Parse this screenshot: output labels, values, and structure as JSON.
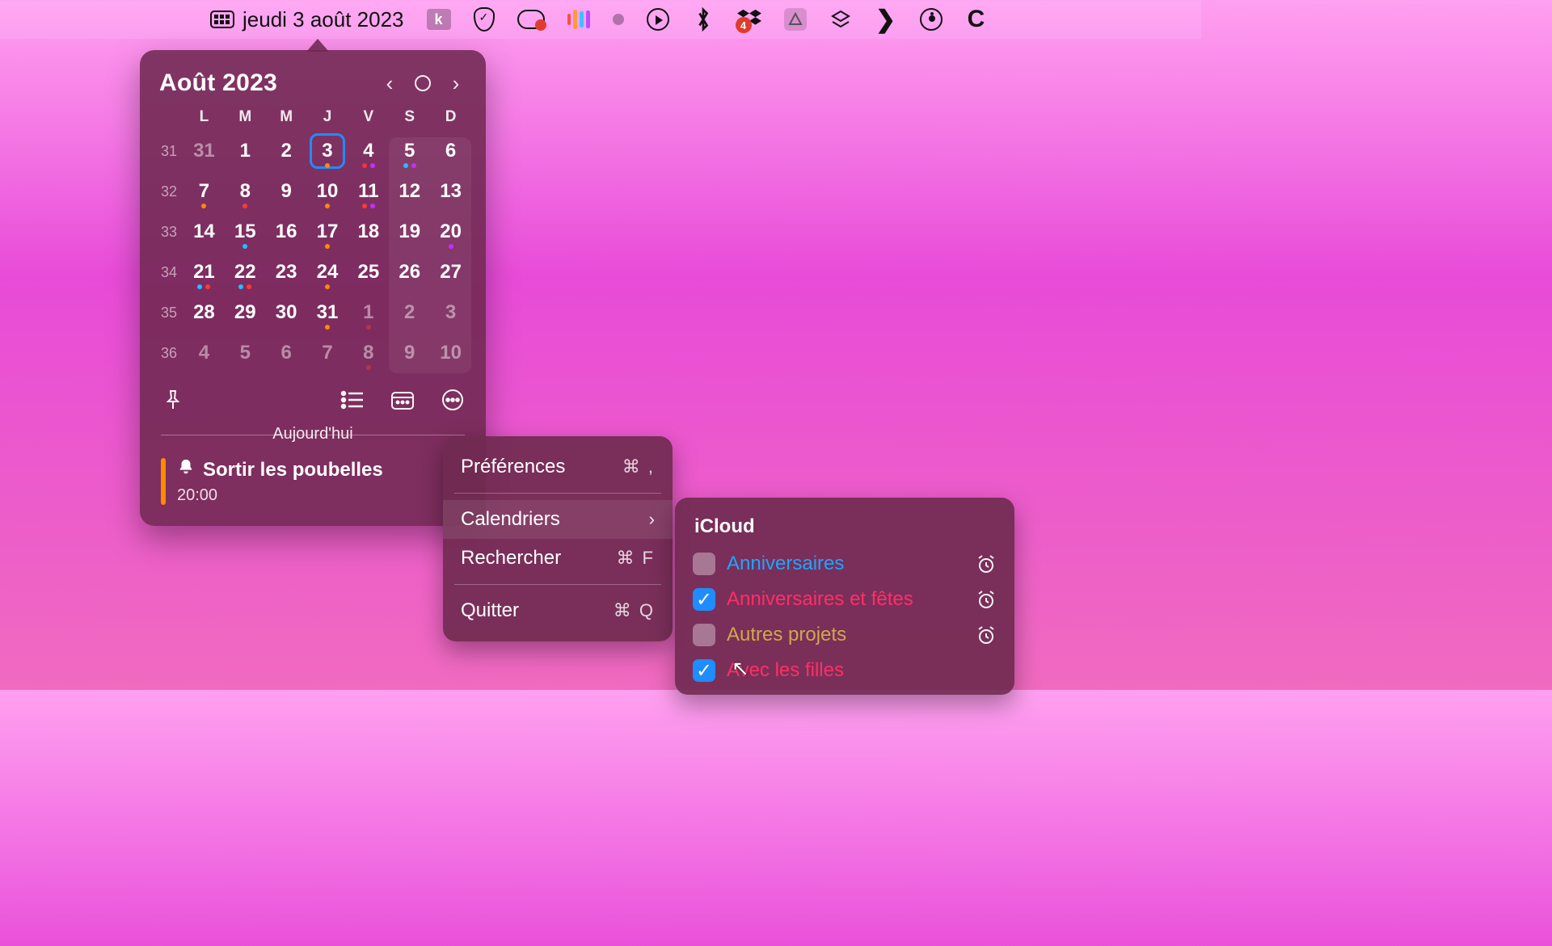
{
  "menubar": {
    "date_label": "jeudi 3 août 2023",
    "dropbox_badge": "4"
  },
  "calendar": {
    "title": "Août 2023",
    "dow": [
      "L",
      "M",
      "M",
      "J",
      "V",
      "S",
      "D"
    ],
    "weeks": [
      {
        "wk": "31",
        "days": [
          {
            "n": "31",
            "dim": true
          },
          {
            "n": "1"
          },
          {
            "n": "2"
          },
          {
            "n": "3",
            "selected": true,
            "dots": [
              "#ff8a00"
            ]
          },
          {
            "n": "4",
            "dots": [
              "#ff3030",
              "#c030ff"
            ]
          },
          {
            "n": "5",
            "dots": [
              "#20c0ff",
              "#c030ff"
            ]
          },
          {
            "n": "6"
          }
        ]
      },
      {
        "wk": "32",
        "days": [
          {
            "n": "7",
            "dots": [
              "#ff8a00"
            ]
          },
          {
            "n": "8",
            "dots": [
              "#ff3b30"
            ]
          },
          {
            "n": "9"
          },
          {
            "n": "10",
            "dots": [
              "#ff8a00"
            ]
          },
          {
            "n": "11",
            "dots": [
              "#ff3b30",
              "#c030ff"
            ]
          },
          {
            "n": "12"
          },
          {
            "n": "13"
          }
        ]
      },
      {
        "wk": "33",
        "days": [
          {
            "n": "14"
          },
          {
            "n": "15",
            "dots": [
              "#20c0ff"
            ]
          },
          {
            "n": "16"
          },
          {
            "n": "17",
            "dots": [
              "#ff8a00"
            ]
          },
          {
            "n": "18"
          },
          {
            "n": "19"
          },
          {
            "n": "20",
            "dots": [
              "#c030ff"
            ]
          }
        ]
      },
      {
        "wk": "34",
        "days": [
          {
            "n": "21",
            "dots": [
              "#20c0ff",
              "#ff3b30"
            ]
          },
          {
            "n": "22",
            "dots": [
              "#20c0ff",
              "#ff3b30"
            ]
          },
          {
            "n": "23"
          },
          {
            "n": "24",
            "dots": [
              "#ff8a00"
            ]
          },
          {
            "n": "25"
          },
          {
            "n": "26"
          },
          {
            "n": "27"
          }
        ]
      },
      {
        "wk": "35",
        "days": [
          {
            "n": "28"
          },
          {
            "n": "29"
          },
          {
            "n": "30"
          },
          {
            "n": "31",
            "dots": [
              "#ff8a00"
            ]
          },
          {
            "n": "1",
            "dim": true,
            "dots": [
              "#ff3b30"
            ]
          },
          {
            "n": "2",
            "dim": true
          },
          {
            "n": "3",
            "dim": true
          }
        ]
      },
      {
        "wk": "36",
        "days": [
          {
            "n": "4",
            "dim": true
          },
          {
            "n": "5",
            "dim": true
          },
          {
            "n": "6",
            "dim": true
          },
          {
            "n": "7",
            "dim": true
          },
          {
            "n": "8",
            "dim": true,
            "dots": [
              "#ff3b30"
            ]
          },
          {
            "n": "9",
            "dim": true
          },
          {
            "n": "10",
            "dim": true
          }
        ]
      }
    ],
    "today_label": "Aujourd'hui",
    "event": {
      "title": "Sortir les poubelles",
      "time": "20:00"
    }
  },
  "menu": {
    "prefs": {
      "label": "Préférences",
      "shortcut": "⌘  ,"
    },
    "cals": {
      "label": "Calendriers"
    },
    "search": {
      "label": "Rechercher",
      "shortcut": "⌘ F"
    },
    "quit": {
      "label": "Quitter",
      "shortcut": "⌘ Q"
    }
  },
  "submenu": {
    "heading": "iCloud",
    "items": [
      {
        "label": "Anniversaires",
        "color": "#1aa7ff",
        "checked": false,
        "alarm": true
      },
      {
        "label": "Anniversaires et fêtes",
        "color": "#ff2f63",
        "checked": true,
        "alarm": true
      },
      {
        "label": "Autres projets",
        "color": "#d0a84a",
        "checked": false,
        "alarm": true
      },
      {
        "label": "Avec les filles",
        "color": "#ff2f63",
        "checked": true,
        "alarm": false
      }
    ]
  }
}
